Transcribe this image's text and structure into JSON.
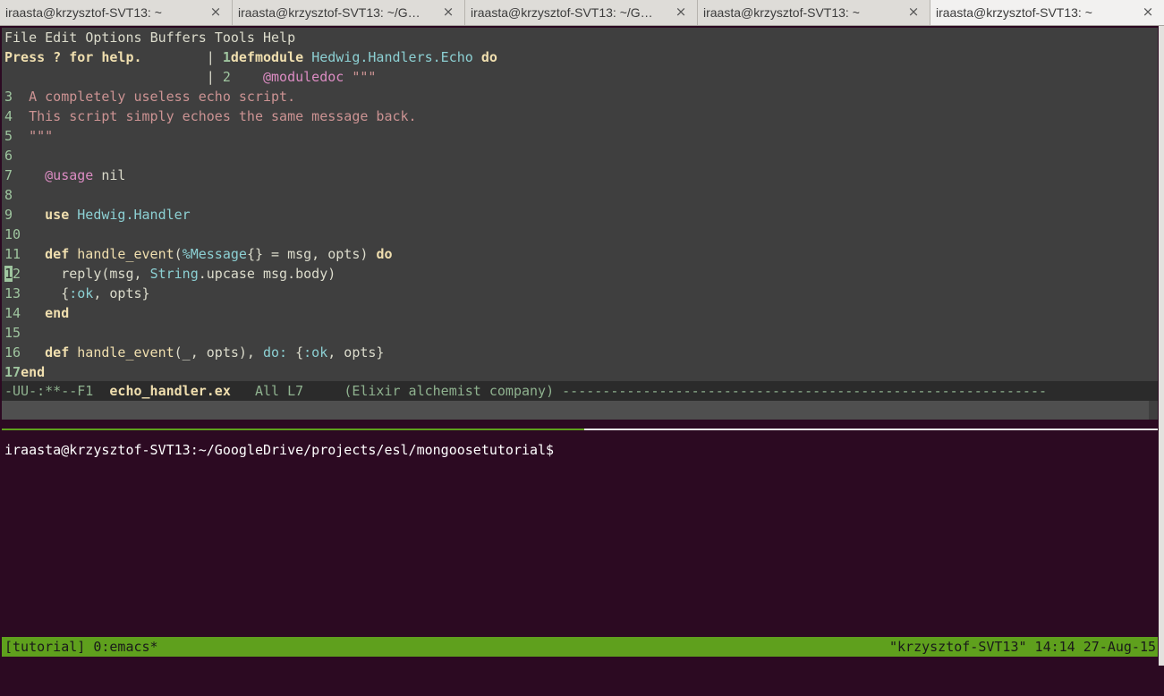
{
  "tabs": [
    {
      "label": "iraasta@krzysztof-SVT13: ~",
      "close": "×"
    },
    {
      "label": "iraasta@krzysztof-SVT13: ~/G…",
      "close": "×"
    },
    {
      "label": "iraasta@krzysztof-SVT13: ~/G…",
      "close": "×"
    },
    {
      "label": "iraasta@krzysztof-SVT13: ~",
      "close": "×"
    },
    {
      "label": "iraasta@krzysztof-SVT13: ~",
      "close": "×"
    }
  ],
  "emacs": {
    "menu": [
      "File",
      "Edit",
      "Options",
      "Buffers",
      "Tools",
      "Help"
    ],
    "help_hint": "Press ? for help.",
    "code": {
      "l1": {
        "num": "1",
        "kw": "defmodule",
        "mod": "Hedwig.Handlers.Echo",
        "do": "do"
      },
      "l2": {
        "num": "2",
        "attr": "@moduledoc",
        "str": "\"\"\""
      },
      "l3": {
        "num": "3",
        "text": "A completely useless echo script."
      },
      "l4": {
        "num": "4",
        "text": "This script simply echoes the same message back."
      },
      "l5": {
        "num": "5",
        "text": "\"\"\""
      },
      "l6": {
        "num": "6"
      },
      "l7": {
        "num": "7",
        "attr": "@usage",
        "rest": " nil"
      },
      "l8": {
        "num": "8"
      },
      "l9": {
        "num": "9",
        "kw": "use",
        "mod": "Hedwig.Handler"
      },
      "l10": {
        "num": "10"
      },
      "l11": {
        "num": "11",
        "kw": "def",
        "func": "handle_event",
        "p1": "(",
        "struct": "%Message",
        "p2": "{} = msg, opts) ",
        "do": "do"
      },
      "l12": {
        "num_cursor": "1",
        "num_rest": "2",
        "a": "reply(msg, ",
        "mod": "String",
        "b": ".upcase msg.body)"
      },
      "l13": {
        "num": "13",
        "a": "{",
        "atom": ":ok",
        "b": ", opts}"
      },
      "l14": {
        "num": "14",
        "kw": "end"
      },
      "l15": {
        "num": "15"
      },
      "l16": {
        "num": "16",
        "kw": "def",
        "func": "handle_event",
        "a": "(_, opts), ",
        "atom1": "do:",
        "b": " {",
        "atom2": ":ok",
        "c": ", opts}"
      },
      "l17": {
        "num": "17",
        "kw": "end"
      }
    },
    "modeline": {
      "status": "-UU-:**--F1  ",
      "file": "echo_handler.ex",
      "position": "   All L7     ",
      "modes": "(Elixir alchemist company) ",
      "fill": "------------------------------------------------------------"
    }
  },
  "terminal": {
    "prompt": "iraasta@krzysztof-SVT13:~/GoogleDrive/projects/esl/mongoosetutorial$"
  },
  "tmux": {
    "left": "[tutorial] 0:emacs*",
    "right": "\"krzysztof-SVT13\" 14:14 27-Aug-15"
  },
  "colors": {
    "emacs_bg": "#3f3f3f",
    "terminal_bg": "#2c0a22",
    "status_bar": "#5fa01d"
  }
}
